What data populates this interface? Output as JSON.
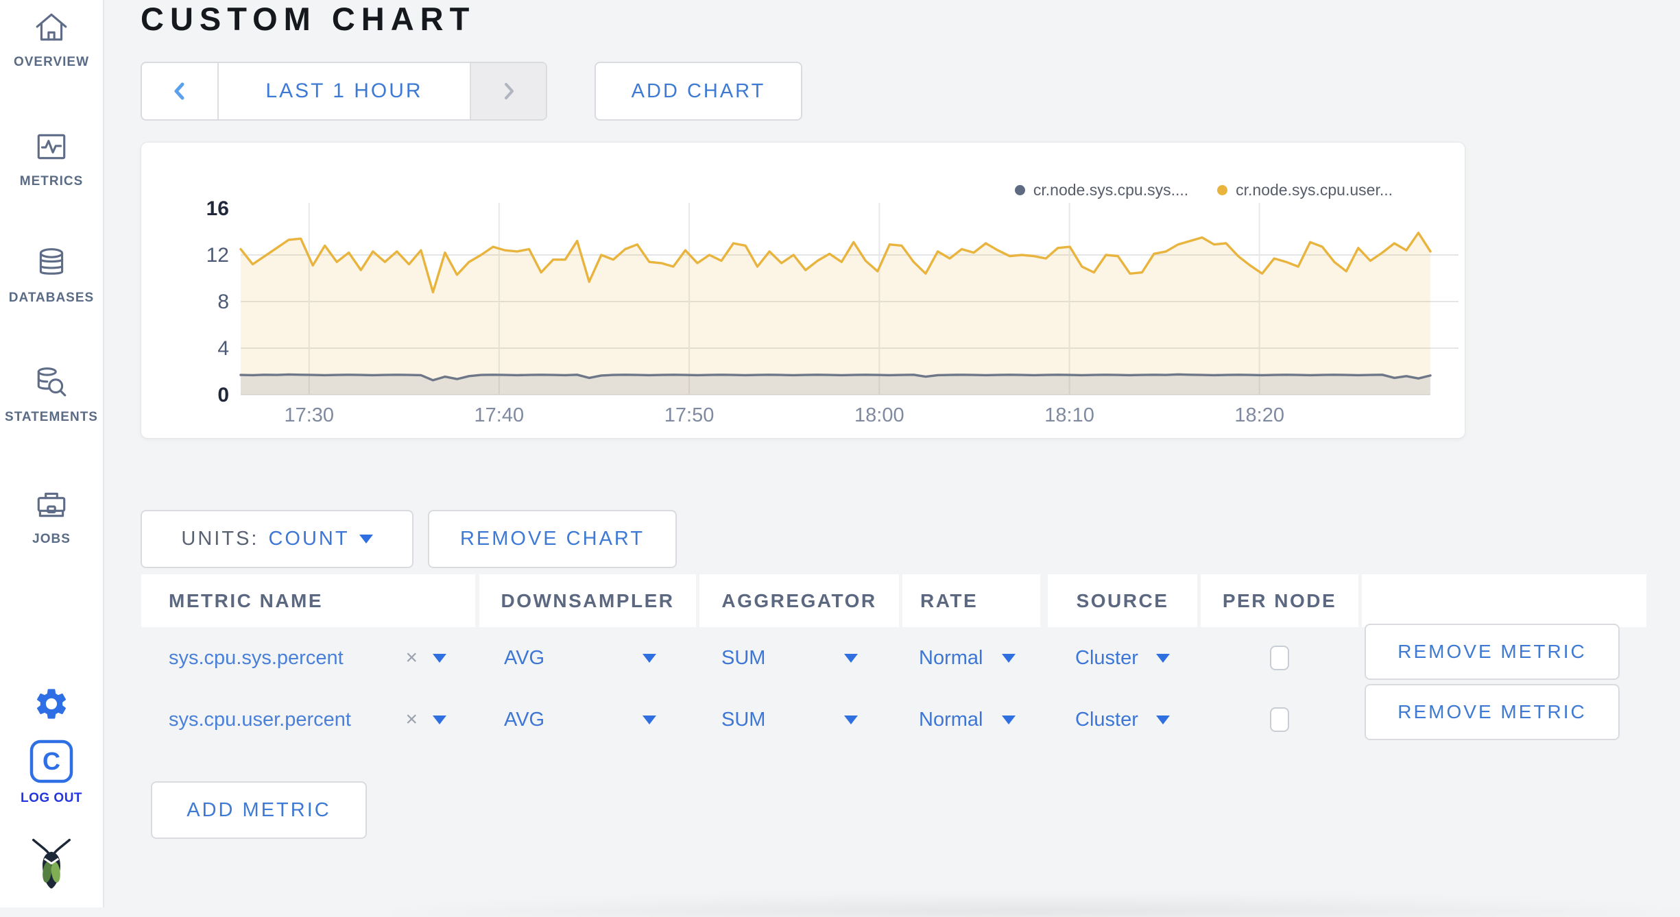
{
  "sidebar": {
    "items": [
      {
        "label": "OVERVIEW"
      },
      {
        "label": "METRICS"
      },
      {
        "label": "DATABASES"
      },
      {
        "label": "STATEMENTS"
      },
      {
        "label": "JOBS"
      }
    ],
    "logout_label": "LOG OUT"
  },
  "header": {
    "title": "CUSTOM CHART"
  },
  "toolbar": {
    "time_range": "LAST 1 HOUR",
    "add_chart": "ADD CHART"
  },
  "chart_data": {
    "type": "line",
    "title": "",
    "xlabel": "",
    "ylabel": "",
    "ylim": [
      0,
      16
    ],
    "y_ticks": [
      0,
      4,
      8,
      12,
      16
    ],
    "grid": true,
    "legend_position": "top-right",
    "x_ticks": [
      {
        "label": "17:30",
        "frac": 0.0575
      },
      {
        "label": "17:40",
        "frac": 0.2172
      },
      {
        "label": "17:50",
        "frac": 0.377
      },
      {
        "label": "18:00",
        "frac": 0.5368
      },
      {
        "label": "18:10",
        "frac": 0.6966
      },
      {
        "label": "18:20",
        "frac": 0.8563
      }
    ],
    "series": [
      {
        "name": "cr.node.sys.cpu.sys....",
        "color": "#6e7787",
        "fill": "rgba(110,119,135,0.16)",
        "values": [
          1.7,
          1.68,
          1.72,
          1.7,
          1.74,
          1.72,
          1.7,
          1.68,
          1.7,
          1.72,
          1.7,
          1.68,
          1.7,
          1.72,
          1.7,
          1.68,
          1.25,
          1.55,
          1.35,
          1.6,
          1.7,
          1.72,
          1.7,
          1.68,
          1.7,
          1.72,
          1.7,
          1.68,
          1.72,
          1.45,
          1.65,
          1.7,
          1.72,
          1.7,
          1.68,
          1.7,
          1.72,
          1.7,
          1.68,
          1.7,
          1.72,
          1.7,
          1.68,
          1.7,
          1.72,
          1.7,
          1.68,
          1.7,
          1.72,
          1.7,
          1.68,
          1.7,
          1.72,
          1.7,
          1.68,
          1.7,
          1.72,
          1.55,
          1.68,
          1.7,
          1.72,
          1.7,
          1.68,
          1.7,
          1.72,
          1.7,
          1.68,
          1.7,
          1.72,
          1.7,
          1.68,
          1.7,
          1.72,
          1.7,
          1.68,
          1.7,
          1.72,
          1.7,
          1.75,
          1.72,
          1.7,
          1.68,
          1.7,
          1.72,
          1.7,
          1.68,
          1.7,
          1.72,
          1.7,
          1.68,
          1.7,
          1.72,
          1.7,
          1.68,
          1.7,
          1.72,
          1.45,
          1.6,
          1.4,
          1.65
        ]
      },
      {
        "name": "cr.node.sys.cpu.user...",
        "color": "#e8b43e",
        "fill": "rgba(232,180,62,0.13)",
        "values": [
          12.5,
          11.2,
          11.9,
          12.6,
          13.3,
          13.4,
          11.1,
          12.8,
          11.4,
          12.2,
          10.7,
          12.3,
          11.4,
          12.3,
          11.2,
          12.4,
          8.8,
          12.2,
          10.3,
          11.4,
          12.0,
          12.7,
          12.4,
          12.3,
          12.5,
          10.5,
          11.6,
          11.6,
          13.2,
          9.7,
          12.0,
          11.6,
          12.5,
          12.9,
          11.4,
          11.3,
          11.0,
          12.4,
          11.3,
          12.0,
          11.5,
          13.0,
          12.8,
          11.0,
          12.3,
          11.3,
          12.0,
          10.7,
          11.5,
          12.1,
          11.4,
          13.1,
          11.5,
          10.6,
          12.9,
          12.8,
          11.4,
          10.4,
          12.3,
          11.7,
          12.5,
          12.2,
          13.0,
          12.4,
          11.9,
          12.0,
          11.9,
          11.7,
          12.6,
          12.7,
          11.0,
          10.5,
          12.0,
          11.9,
          10.4,
          10.5,
          12.1,
          12.3,
          12.9,
          13.2,
          13.5,
          12.9,
          13.0,
          11.9,
          11.1,
          10.4,
          11.7,
          11.4,
          11.0,
          13.1,
          12.7,
          11.4,
          10.6,
          12.6,
          11.5,
          12.2,
          13.0,
          12.4,
          13.9,
          12.3
        ]
      }
    ]
  },
  "chart_controls": {
    "units_label": "UNITS:",
    "units_value": "COUNT",
    "remove_chart": "REMOVE CHART"
  },
  "metrics_table": {
    "clear_glyph": "×",
    "columns": [
      "METRIC NAME",
      "DOWNSAMPLER",
      "AGGREGATOR",
      "RATE",
      "SOURCE",
      "PER NODE",
      ""
    ],
    "rows": [
      {
        "name": "sys.cpu.sys.percent",
        "downsampler": "AVG",
        "aggregator": "SUM",
        "rate": "Normal",
        "source": "Cluster",
        "per_node_checked": false,
        "remove_label": "REMOVE METRIC"
      },
      {
        "name": "sys.cpu.user.percent",
        "downsampler": "AVG",
        "aggregator": "SUM",
        "rate": "Normal",
        "source": "Cluster",
        "per_node_checked": false,
        "remove_label": "REMOVE METRIC"
      }
    ],
    "add_metric": "ADD METRIC"
  }
}
